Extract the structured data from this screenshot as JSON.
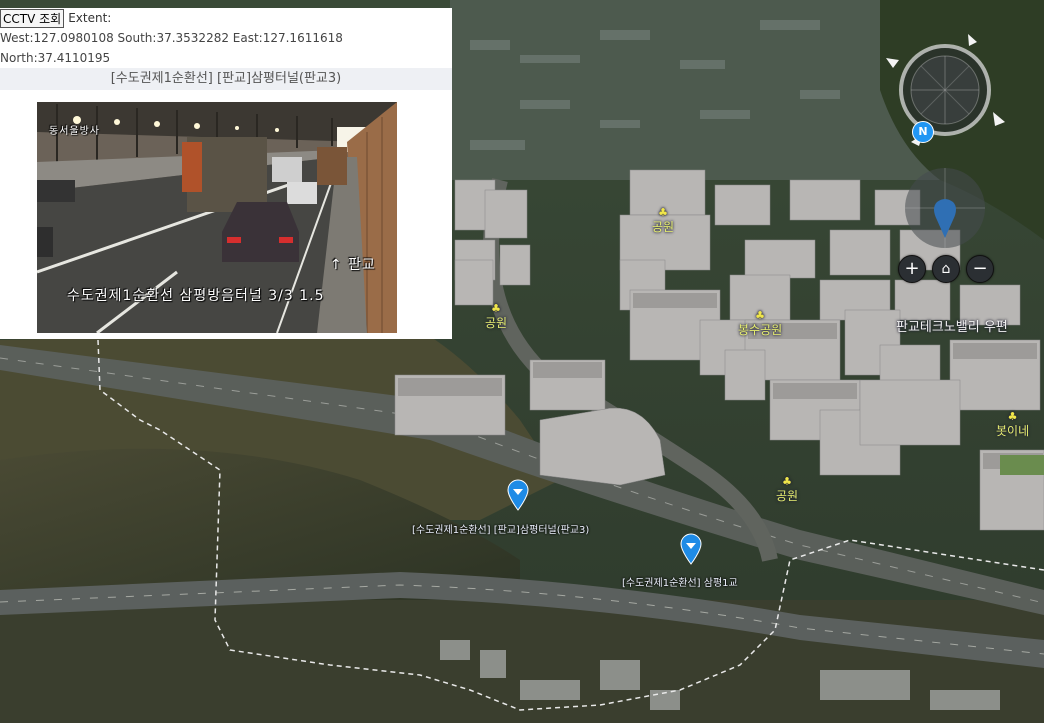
{
  "popup": {
    "button_label": "CCTV 조회",
    "extent_label": "Extent:",
    "extent_line1": "West:127.0980108 South:37.3532282 East:127.1611618",
    "extent_line2": "North:37.4110195",
    "title": "[수도권제1순환선] [판교]삼평터널(판교3)",
    "video": {
      "caption": "수도권제1순환선 삼평방음터널 3/3 1.5",
      "direction_label": "↑ 판교",
      "corner_text": "동서울방사"
    }
  },
  "map": {
    "places": [
      {
        "label": "공원"
      },
      {
        "label": "공원"
      },
      {
        "label": "봉수공원"
      },
      {
        "label": "공원"
      },
      {
        "label": "판교테크노밸리 우편"
      },
      {
        "label": "봇이네"
      }
    ],
    "markers": [
      {
        "label": "[수도권제1순환선] [판교]삼평터널(판교3)"
      },
      {
        "label": "[수도권제1순환선] 삼평1교"
      }
    ]
  },
  "nav": {
    "compass_letter": "N",
    "zoom_in": "+",
    "home": "⌂",
    "zoom_out": "−"
  },
  "colors": {
    "marker": "#1e8be6",
    "accent_label": "#e8f070"
  },
  "icons": [
    "compass-icon",
    "north-arrow-icon",
    "tilt-icon",
    "zoom-in-icon",
    "home-icon",
    "zoom-out-icon",
    "map-marker-icon",
    "park-icon"
  ]
}
